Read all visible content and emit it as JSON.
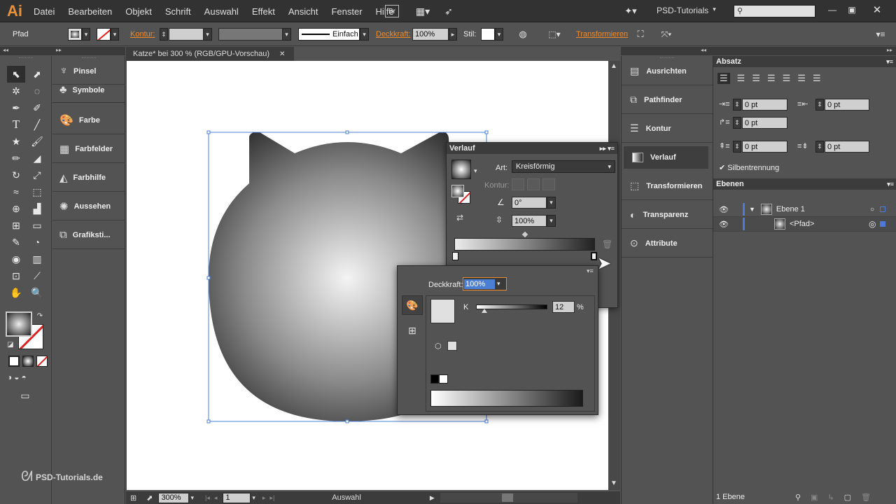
{
  "app": {
    "logo": "Ai",
    "workspace": "PSD-Tutorials",
    "menu": [
      "Datei",
      "Bearbeiten",
      "Objekt",
      "Schrift",
      "Auswahl",
      "Effekt",
      "Ansicht",
      "Fenster",
      "Hilfe"
    ],
    "br_label": "Br"
  },
  "control_bar": {
    "selection": "Pfad",
    "kontur_label": "Kontur:",
    "stroke_style": "Einfach",
    "deckkraft_label": "Deckkraft:",
    "deckkraft_value": "100%",
    "stil_label": "Stil:",
    "transform_link": "Transformieren"
  },
  "document": {
    "tab_title": "Katze* bei 300 % (RGB/GPU-Vorschau)",
    "zoom": "300%",
    "page": "1",
    "status": "Auswahl"
  },
  "left_dock": [
    "Pinsel",
    "Symbole",
    "Farbe",
    "Farbfelder",
    "Farbhilfe",
    "Aussehen",
    "Grafiksti..."
  ],
  "right_dock": [
    "Ausrichten",
    "Pathfinder",
    "Kontur",
    "Verlauf",
    "Transformieren",
    "Transparenz",
    "Attribute"
  ],
  "absatz": {
    "title": "Absatz",
    "indent_left": "0 pt",
    "indent_right": "0 pt",
    "first_line": "0 pt",
    "space_before": "0 pt",
    "space_after": "0 pt",
    "hyphenation": "Silbentrennung"
  },
  "ebenen": {
    "title": "Ebenen",
    "layers": [
      {
        "name": "Ebene 1"
      },
      {
        "name": "<Pfad>"
      }
    ],
    "footer": "1 Ebene"
  },
  "verlauf": {
    "title": "Verlauf",
    "art_label": "Art:",
    "art_value": "Kreisförmig",
    "kontur_label": "Kontur:",
    "angle": "0°",
    "ratio": "100%"
  },
  "color_popup": {
    "deckkraft_label": "Deckkraft:",
    "deckkraft_value": "100%",
    "channel": "K",
    "k_value": "12",
    "k_unit": "%",
    "k_fraction": 0.12
  },
  "watermark": "PSD-Tutorials.de"
}
